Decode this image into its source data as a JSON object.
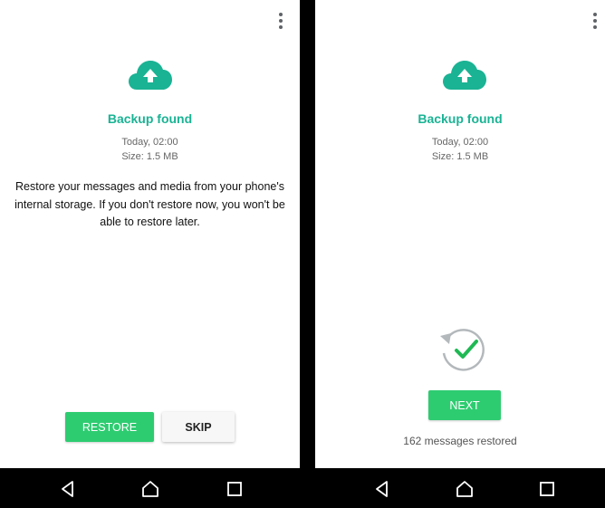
{
  "left_screen": {
    "title": "Backup found",
    "date": "Today, 02:00",
    "size": "Size: 1.5 MB",
    "description": "Restore your messages and media from your phone's internal storage. If you don't restore now, you won't be able to restore later.",
    "restore_label": "RESTORE",
    "skip_label": "SKIP"
  },
  "right_screen": {
    "title": "Backup found",
    "date": "Today, 02:00",
    "size": "Size: 1.5 MB",
    "next_label": "NEXT",
    "status": "162 messages restored"
  },
  "icons": {
    "cloud": "cloud-upload-icon",
    "menu": "more-vert-icon",
    "restored": "sync-check-icon",
    "nav": [
      "back-icon",
      "home-icon",
      "recents-icon"
    ]
  },
  "colors": {
    "accent": "#1ab394",
    "button": "#2ecc71",
    "check": "#1fb954"
  }
}
